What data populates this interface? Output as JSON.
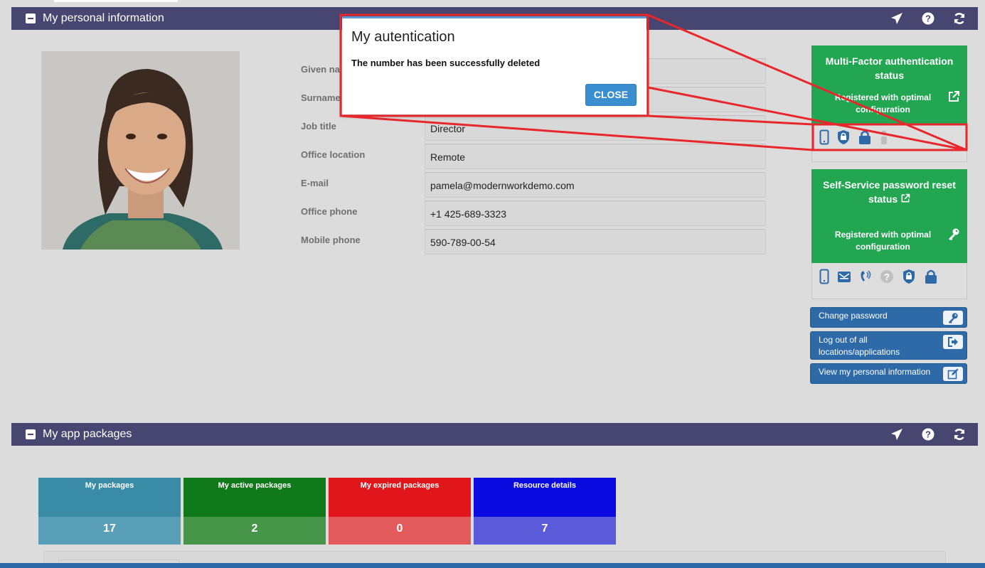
{
  "panels": {
    "personal": {
      "title": "My personal information"
    },
    "apps": {
      "title": "My app packages"
    }
  },
  "bar_icons": [
    "send-icon",
    "help-icon",
    "refresh-icon"
  ],
  "form": {
    "fields": [
      {
        "label": "Given name",
        "value": ""
      },
      {
        "label": "Surname",
        "value": ""
      },
      {
        "label": "Job title",
        "value": "Director"
      },
      {
        "label": "Office location",
        "value": "Remote"
      },
      {
        "label": "E-mail",
        "value": "pamela@modernworkdemo.com"
      },
      {
        "label": "Office phone",
        "value": "+1 425-689-3323"
      },
      {
        "label": "Mobile phone",
        "value": "590-789-00-54"
      }
    ],
    "visible_label_fragments": {
      "given": "Given na",
      "surname": "Surname"
    }
  },
  "mfa": {
    "title": "Multi-Factor authentication status",
    "status": "Registered with optimal configuration",
    "methods": [
      "mobile-phone-icon",
      "shield-lock-icon",
      "lock-icon",
      "user-icon"
    ]
  },
  "sspr": {
    "title": "Self-Service password reset status",
    "status": "Registered with optimal configuration",
    "methods": [
      "mobile-phone-icon",
      "email-icon",
      "phone-call-icon",
      "question-icon",
      "shield-lock-icon",
      "lock-icon"
    ]
  },
  "actions": {
    "change_password": "Change password",
    "logout_line1": "Log out of all",
    "logout_line2": "locations/applications",
    "view_info": "View my personal information"
  },
  "tiles": [
    {
      "label": "My packages",
      "value": "17",
      "top_color": "#3a8ba6",
      "bottom_color": "#599fb7"
    },
    {
      "label": "My active packages",
      "value": "2",
      "top_color": "#10791a",
      "bottom_color": "#479549"
    },
    {
      "label": "My expired packages",
      "value": "0",
      "top_color": "#e1161a",
      "bottom_color": "#e25a5c"
    },
    {
      "label": "Resource details",
      "value": "7",
      "top_color": "#0a0be0",
      "bottom_color": "#5b5bda"
    }
  ],
  "modal": {
    "title": "My autentication",
    "message": "The number has been successfully deleted",
    "close_label": "CLOSE"
  },
  "colors": {
    "panel_bar": "#474670",
    "success_green": "#22a651",
    "action_blue": "#2e6aa8",
    "annotation_red": "#e8262b"
  }
}
